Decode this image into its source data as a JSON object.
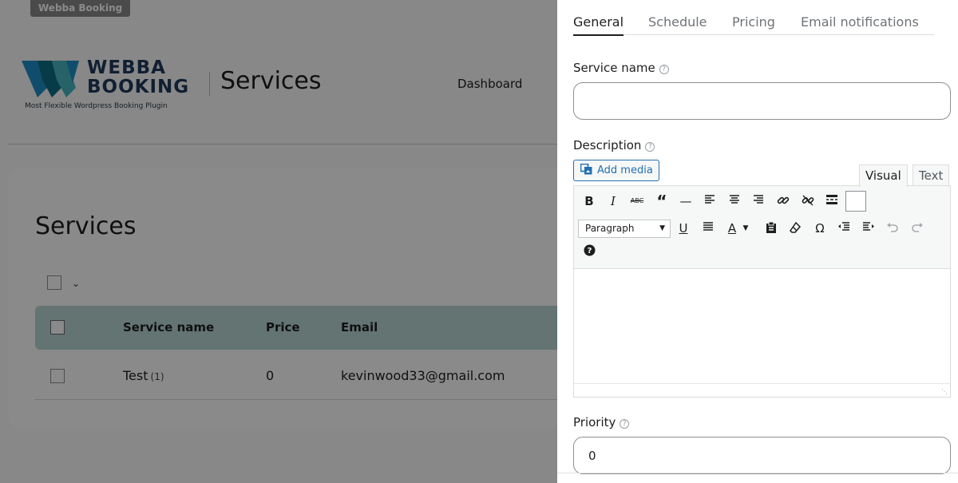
{
  "background": {
    "adminbar_tag": "Webba Booking",
    "logo": {
      "line1": "WEBBA",
      "line2": "BOOKING",
      "tagline": "Most Flexible Wordpress Booking Plugin"
    },
    "header_title": "Services",
    "nav_dashboard": "Dashboard",
    "services_heading": "Services",
    "table": {
      "columns": [
        "Service name",
        "Price",
        "Email"
      ],
      "rows": [
        {
          "name": "Test",
          "count": "(1)",
          "price": "0",
          "email": "kevinwood33@gmail.com"
        }
      ]
    }
  },
  "panel": {
    "tabs": [
      {
        "label": "General",
        "active": true
      },
      {
        "label": "Schedule",
        "active": false
      },
      {
        "label": "Pricing",
        "active": false
      },
      {
        "label": "Email notifications",
        "active": false
      }
    ],
    "service_name": {
      "label": "Service name",
      "value": ""
    },
    "description": {
      "label": "Description",
      "add_media": "Add media",
      "editor_tabs": [
        "Visual",
        "Text"
      ],
      "format_select": "Paragraph"
    },
    "priority": {
      "label": "Priority",
      "value": "0"
    },
    "help_glyph": "?"
  },
  "colors": {
    "accent_link": "#2271b1",
    "table_header": "#b8d7d3",
    "overlay": "rgba(0,0,0,0.46)"
  }
}
